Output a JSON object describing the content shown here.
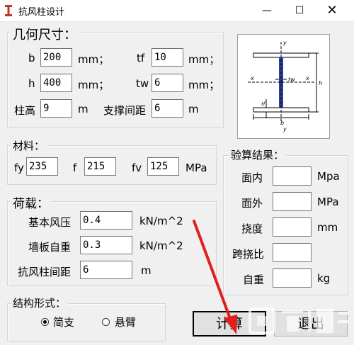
{
  "window": {
    "title": "抗风柱设计",
    "minimize_glyph": "—",
    "maximize_glyph": "☐",
    "close_glyph": "✕"
  },
  "dims": {
    "legend": "几何尺寸：",
    "b": {
      "label": "b",
      "value": "200",
      "unit": "mm；"
    },
    "tf": {
      "label": "tf",
      "value": "10",
      "unit": "mm；"
    },
    "h": {
      "label": "h",
      "value": "400",
      "unit": "mm；"
    },
    "tw": {
      "label": "tw",
      "value": "6",
      "unit": "mm；"
    },
    "col_height": {
      "label": "柱高",
      "value": "9",
      "unit": "m"
    },
    "brace_spacing": {
      "label": "支撑间距",
      "value": "6",
      "unit": "m"
    }
  },
  "diagram": {
    "icon": "i-beam-section-diagram",
    "y_top": "y",
    "y_bottom": "y",
    "x_left": "x",
    "x_right": "x",
    "tw": "tw",
    "h": "h",
    "tf": "tf",
    "b": "b"
  },
  "material": {
    "legend": "材料：",
    "fy": {
      "label": "fy",
      "value": "235"
    },
    "f": {
      "label": "f",
      "value": "215"
    },
    "fv": {
      "label": "fv",
      "value": "125",
      "unit": "MPa"
    }
  },
  "load": {
    "legend": "荷载：",
    "wind": {
      "label": "基本风压",
      "value": "0.4",
      "unit": "kN/m^2"
    },
    "wall": {
      "label": "墙板自重",
      "value": "0.3",
      "unit": "kN/m^2"
    },
    "spacing": {
      "label": "抗风柱间距",
      "value": "6",
      "unit": "m"
    }
  },
  "results": {
    "legend": "验算结果：",
    "in_plane": {
      "label": "面内",
      "value": "",
      "unit": "Mpa"
    },
    "out_plane": {
      "label": "面外",
      "value": "",
      "unit": "MPa"
    },
    "deflection": {
      "label": "挠度",
      "value": "",
      "unit": "mm"
    },
    "span_ratio": {
      "label": "跨挠比",
      "value": "",
      "unit": ""
    },
    "self_weight": {
      "label": "自重",
      "value": "",
      "unit": "kg"
    }
  },
  "structure": {
    "legend": "结构形式：",
    "options": [
      {
        "label": "简支",
        "selected": true
      },
      {
        "label": "悬臂",
        "selected": false
      }
    ]
  },
  "buttons": {
    "calc": "计算",
    "exit": "退出"
  },
  "colors": {
    "arrow": "#e02020",
    "window_bg": "#f0f0f0",
    "border": "#d5d5d5"
  }
}
